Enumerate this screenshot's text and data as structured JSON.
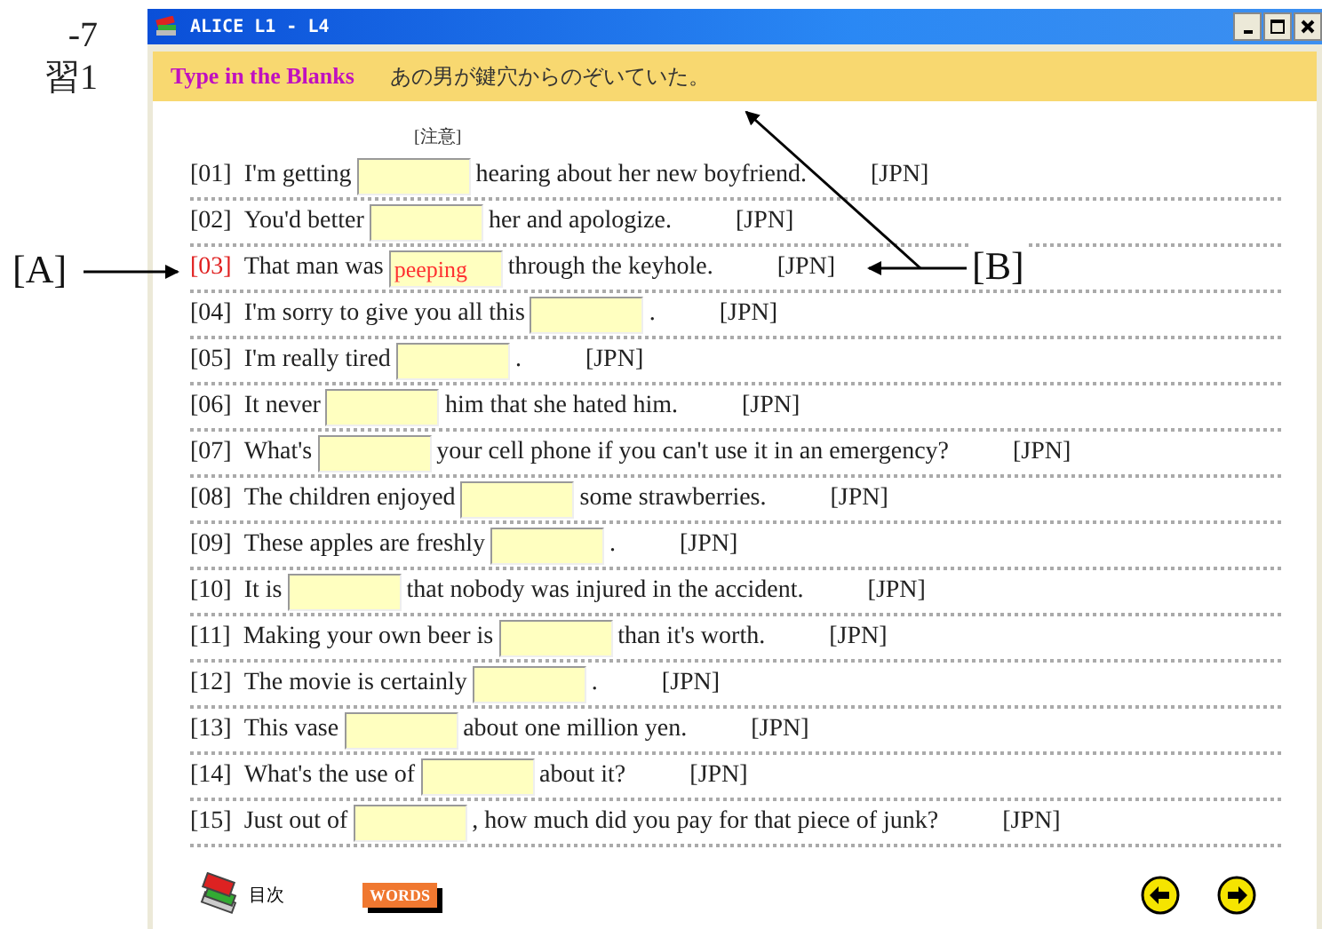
{
  "page_text": [
    "-7",
    "習1"
  ],
  "window": {
    "title": "ALICE L1 - L4"
  },
  "header": {
    "title": "Type in the Blanks",
    "translation": "あの男が鍵穴からのぞいていた。"
  },
  "note_label": "[注意]",
  "rows": [
    {
      "number": "[01]",
      "before": "I'm getting",
      "after": "hearing about her new boyfriend.",
      "jpn": "[JPN]",
      "selected": false
    },
    {
      "number": "[02]",
      "before": "You'd better",
      "after": "her and apologize.",
      "jpn": "[JPN]",
      "selected": false
    },
    {
      "number": "[03]",
      "before": "That man was",
      "value": "peeping",
      "after": "through the keyhole.",
      "jpn": "[JPN]",
      "selected": true
    },
    {
      "number": "[04]",
      "before": "I'm sorry to give you all this",
      "after": ".",
      "jpn": "[JPN]",
      "selected": false
    },
    {
      "number": "[05]",
      "before": "I'm really tired",
      "after": ".",
      "jpn": "[JPN]",
      "selected": false
    },
    {
      "number": "[06]",
      "before": "It never",
      "after": "him that she hated him.",
      "jpn": "[JPN]",
      "selected": false
    },
    {
      "number": "[07]",
      "before": "What's",
      "after": "your cell phone if you can't use it in an emergency?",
      "jpn": "[JPN]",
      "selected": false
    },
    {
      "number": "[08]",
      "before": "The children enjoyed",
      "after": "some strawberries.",
      "jpn": "[JPN]",
      "selected": false
    },
    {
      "number": "[09]",
      "before": "These apples are freshly",
      "after": ".",
      "jpn": "[JPN]",
      "selected": false
    },
    {
      "number": "[10]",
      "before": "It is",
      "after": "that nobody was injured in the accident.",
      "jpn": "[JPN]",
      "selected": false
    },
    {
      "number": "[11]",
      "before": "Making your own beer is",
      "after": "than it's worth.",
      "jpn": "[JPN]",
      "selected": false
    },
    {
      "number": "[12]",
      "before": "The movie is certainly",
      "after": ".",
      "jpn": "[JPN]",
      "selected": false
    },
    {
      "number": "[13]",
      "before": "This vase",
      "after": "about one million yen.",
      "jpn": "[JPN]",
      "selected": false
    },
    {
      "number": "[14]",
      "before": "What's the use of",
      "after": "about it?",
      "jpn": "[JPN]",
      "selected": false
    },
    {
      "number": "[15]",
      "before": "Just out of",
      "after": ", how much did you pay for that piece of junk?",
      "jpn": "[JPN]",
      "selected": false
    }
  ],
  "footer": {
    "contents_label": "目次",
    "words_button": "WORDS"
  },
  "annotations": [
    {
      "label": "[A]"
    },
    {
      "label": "[B]"
    }
  ]
}
